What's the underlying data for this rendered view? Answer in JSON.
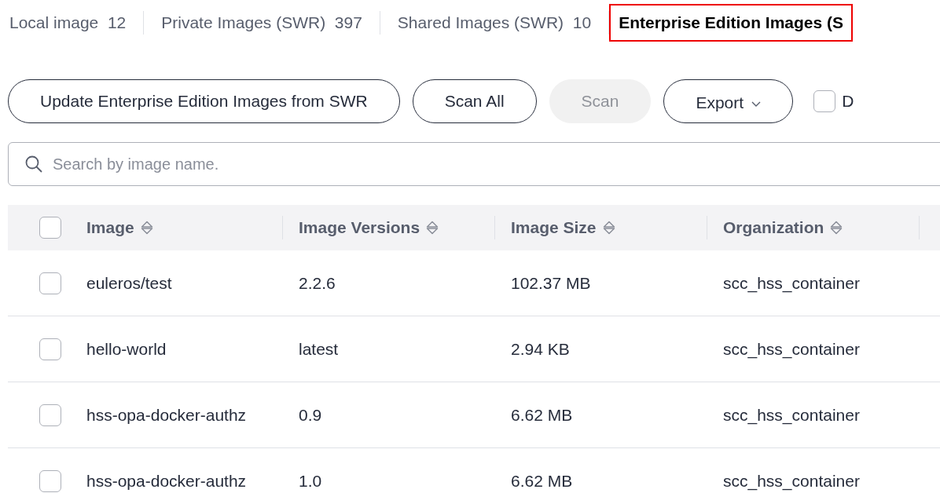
{
  "tabs": [
    {
      "label": "Local image",
      "count": "12",
      "selected": false
    },
    {
      "label": "Private Images (SWR)",
      "count": "397",
      "selected": false
    },
    {
      "label": "Shared Images (SWR)",
      "count": "10",
      "selected": false
    },
    {
      "label": "Enterprise Edition Images (S",
      "selected": true
    }
  ],
  "toolbar": {
    "buttons": [
      {
        "label": "Update Enterprise Edition Images from SWR",
        "disabled": false,
        "dropdown": false
      },
      {
        "label": "Scan All",
        "disabled": false,
        "dropdown": false
      },
      {
        "label": "Scan",
        "disabled": true,
        "dropdown": false
      },
      {
        "label": "Export",
        "disabled": false,
        "dropdown": true
      }
    ],
    "checkbox": {
      "label": "D",
      "checked": false
    }
  },
  "search": {
    "placeholder": "Search by image name."
  },
  "table": {
    "columns": [
      "Image",
      "Image Versions",
      "Image Size",
      "Organization"
    ],
    "header_checked": false,
    "rows": [
      {
        "cells": [
          "euleros/test",
          "2.2.6",
          "102.37 MB",
          "scc_hss_container"
        ],
        "selected": false
      },
      {
        "cells": [
          "hello-world",
          "latest",
          "2.94 KB",
          "scc_hss_container"
        ],
        "selected": false
      },
      {
        "cells": [
          "hss-opa-docker-authz",
          "0.9",
          "6.62 MB",
          "scc_hss_container"
        ],
        "selected": false
      },
      {
        "cells": [
          "hss-opa-docker-authz",
          "1.0",
          "6.62 MB",
          "scc_hss_container"
        ],
        "selected": false
      }
    ]
  }
}
